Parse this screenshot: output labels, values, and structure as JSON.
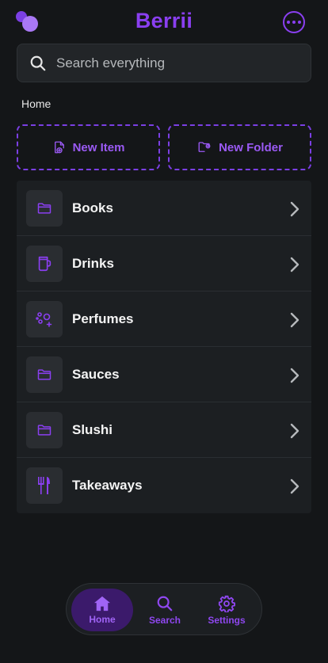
{
  "app": {
    "title": "Berrii",
    "logo_icon": "berry-logo",
    "menu_icon": "more-horizontal-icon"
  },
  "search": {
    "placeholder": "Search everything",
    "icon": "search-icon"
  },
  "breadcrumb": "Home",
  "actions": [
    {
      "label": "New Item",
      "icon": "file-plus-icon"
    },
    {
      "label": "New Folder",
      "icon": "folder-plus-icon"
    }
  ],
  "folders": [
    {
      "label": "Books",
      "icon": "folder-icon"
    },
    {
      "label": "Drinks",
      "icon": "mug-icon"
    },
    {
      "label": "Perfumes",
      "icon": "bubbles-icon"
    },
    {
      "label": "Sauces",
      "icon": "folder-icon"
    },
    {
      "label": "Slushi",
      "icon": "folder-icon"
    },
    {
      "label": "Takeaways",
      "icon": "utensils-icon"
    }
  ],
  "tabs": [
    {
      "label": "Home",
      "icon": "home-icon",
      "active": true
    },
    {
      "label": "Search",
      "icon": "search-icon",
      "active": false
    },
    {
      "label": "Settings",
      "icon": "gear-icon",
      "active": false
    }
  ],
  "colors": {
    "accent": "#8a3ff0",
    "background": "#141618",
    "surface": "#1c1f22",
    "active_tab": "#3b1a6b"
  }
}
